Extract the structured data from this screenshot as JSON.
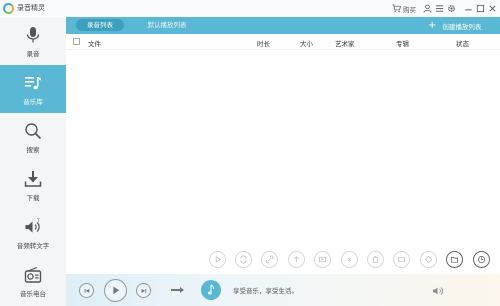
{
  "app": {
    "title": "录音精灵",
    "cart_label": "购买"
  },
  "sidebar": {
    "items": [
      {
        "label": "录音",
        "icon": "microphone-icon",
        "active": false
      },
      {
        "label": "音乐库",
        "icon": "music-list-icon",
        "active": true
      },
      {
        "label": "搜索",
        "icon": "search-icon",
        "active": false
      },
      {
        "label": "下载",
        "icon": "download-icon",
        "active": false
      },
      {
        "label": "音频转文字",
        "icon": "speaker-text-icon",
        "active": false
      },
      {
        "label": "音乐电台",
        "icon": "radio-icon",
        "active": false
      }
    ]
  },
  "tabs": [
    {
      "label": "录音列表",
      "active": true
    },
    {
      "label": "默认播放列表",
      "active": false
    }
  ],
  "create_playlist": "创建播放列表",
  "table": {
    "columns": [
      "文件",
      "时长",
      "大小",
      "艺术家",
      "专辑",
      "状态"
    ],
    "rows": []
  },
  "actions": [
    "play-circle-icon",
    "convert-icon",
    "link-icon",
    "upload-icon",
    "video-icon",
    "close-circle-icon",
    "trash-icon",
    "tag-icon",
    "refresh-icon",
    "folder-icon",
    "clock-icon"
  ],
  "player": {
    "slogan": "享受音乐，享受生活。",
    "mode_icon": "arrow-right-icon"
  },
  "colors": {
    "accent": "#5ab8d4",
    "accent_dark": "#3f9fbf",
    "sidebar_bg": "#f3f5f7"
  }
}
